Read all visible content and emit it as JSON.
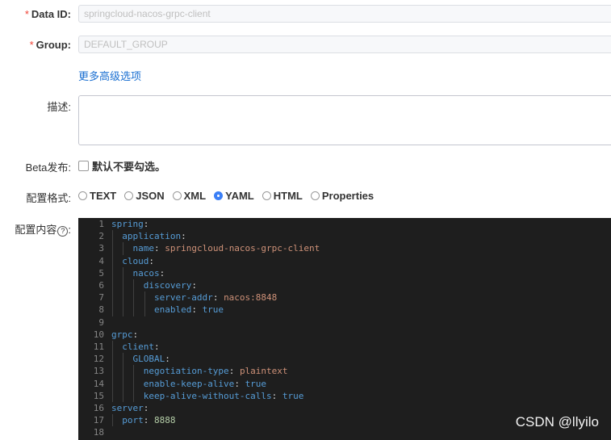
{
  "form": {
    "data_id": {
      "required": "*",
      "label": "Data ID:",
      "value": "springcloud-nacos-grpc-client"
    },
    "group": {
      "required": "*",
      "label": "Group:",
      "value": "DEFAULT_GROUP"
    },
    "advanced_link": "更多高级选项",
    "description": {
      "label": "描述:",
      "value": ""
    },
    "beta": {
      "label": "Beta发布:",
      "checkbox_text": "默认不要勾选。"
    },
    "format": {
      "label": "配置格式:",
      "options": [
        "TEXT",
        "JSON",
        "XML",
        "YAML",
        "HTML",
        "Properties"
      ],
      "selected": "YAML"
    },
    "content": {
      "label": "配置内容",
      "help_icon": "question-circle-icon"
    }
  },
  "editor": {
    "lines": [
      {
        "n": "1",
        "indent": 0,
        "key": "spring",
        "sep": ":",
        "val": "",
        "vt": ""
      },
      {
        "n": "2",
        "indent": 1,
        "key": "application",
        "sep": ":",
        "val": "",
        "vt": ""
      },
      {
        "n": "3",
        "indent": 2,
        "key": "name",
        "sep": ": ",
        "val": "springcloud-nacos-grpc-client",
        "vt": "s"
      },
      {
        "n": "4",
        "indent": 1,
        "key": "cloud",
        "sep": ":",
        "val": "",
        "vt": ""
      },
      {
        "n": "5",
        "indent": 2,
        "key": "nacos",
        "sep": ":",
        "val": "",
        "vt": ""
      },
      {
        "n": "6",
        "indent": 3,
        "key": "discovery",
        "sep": ":",
        "val": "",
        "vt": ""
      },
      {
        "n": "7",
        "indent": 4,
        "key": "server-addr",
        "sep": ": ",
        "val": "nacos:8848",
        "vt": "s"
      },
      {
        "n": "8",
        "indent": 4,
        "key": "enabled",
        "sep": ": ",
        "val": "true",
        "vt": "b"
      },
      {
        "n": "9",
        "indent": 0,
        "key": "",
        "sep": "",
        "val": "",
        "vt": ""
      },
      {
        "n": "10",
        "indent": 0,
        "key": "grpc",
        "sep": ":",
        "val": "",
        "vt": ""
      },
      {
        "n": "11",
        "indent": 1,
        "key": "client",
        "sep": ":",
        "val": "",
        "vt": ""
      },
      {
        "n": "12",
        "indent": 2,
        "key": "GLOBAL",
        "sep": ":",
        "val": "",
        "vt": ""
      },
      {
        "n": "13",
        "indent": 3,
        "key": "negotiation-type",
        "sep": ": ",
        "val": "plaintext",
        "vt": "s"
      },
      {
        "n": "14",
        "indent": 3,
        "key": "enable-keep-alive",
        "sep": ": ",
        "val": "true",
        "vt": "b"
      },
      {
        "n": "15",
        "indent": 3,
        "key": "keep-alive-without-calls",
        "sep": ": ",
        "val": "true",
        "vt": "b"
      },
      {
        "n": "16",
        "indent": 0,
        "key": "server",
        "sep": ":",
        "val": "",
        "vt": ""
      },
      {
        "n": "17",
        "indent": 1,
        "key": "port",
        "sep": ": ",
        "val": "8888",
        "vt": "n"
      },
      {
        "n": "18",
        "indent": 0,
        "key": "",
        "sep": "",
        "val": "",
        "vt": ""
      }
    ]
  },
  "watermark": "CSDN @llyilo",
  "colors": {
    "accent": "#3b7ff6",
    "required": "#f04134",
    "link": "#1a6fd1",
    "editor_bg": "#1e1e1e"
  }
}
